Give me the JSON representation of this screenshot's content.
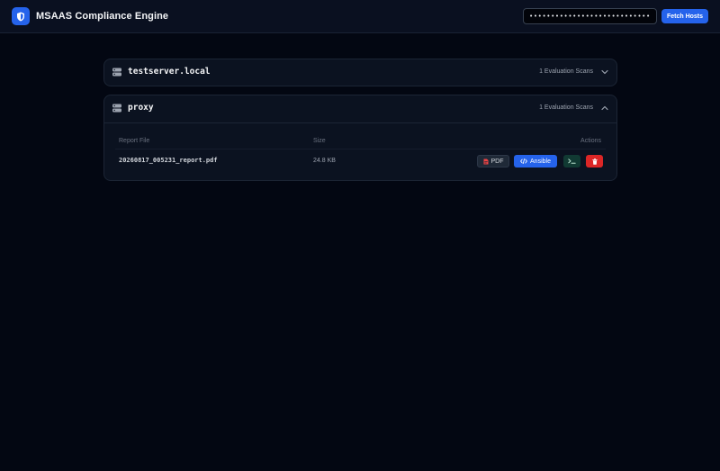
{
  "app": {
    "title": "MSAAS Compliance Engine",
    "logo_icon": "shield-icon",
    "accent_color": "#2563eb"
  },
  "header": {
    "token_value": "••••••••••••••••••••••••••••••••",
    "fetch_label": "Fetch Hosts"
  },
  "hosts": [
    {
      "name": "testserver.local",
      "scan_count": "1 Evaluation Scans",
      "expanded": false
    },
    {
      "name": "proxy",
      "scan_count": "1 Evaluation Scans",
      "expanded": true,
      "table": {
        "headers": [
          "Report File",
          "Size",
          "Actions"
        ],
        "rows": [
          {
            "file": "20260817_005231_report.pdf",
            "size": "24.8 KB",
            "actions": {
              "pdf_label": "PDF",
              "ansible_label": "Ansible"
            }
          }
        ]
      }
    }
  ],
  "icons": {
    "server": "server-icon",
    "chevron_collapsed": "chevron-down-icon",
    "chevron_expanded": "chevron-up-icon",
    "pdf": "pdf-icon",
    "ansible": "code-icon",
    "terminal": "terminal-icon",
    "delete": "trash-icon"
  },
  "colors": {
    "background": "#030712",
    "card": "#0b1220",
    "primary": "#2563eb",
    "danger": "#dc2626",
    "terminal_bg": "#113a33"
  }
}
